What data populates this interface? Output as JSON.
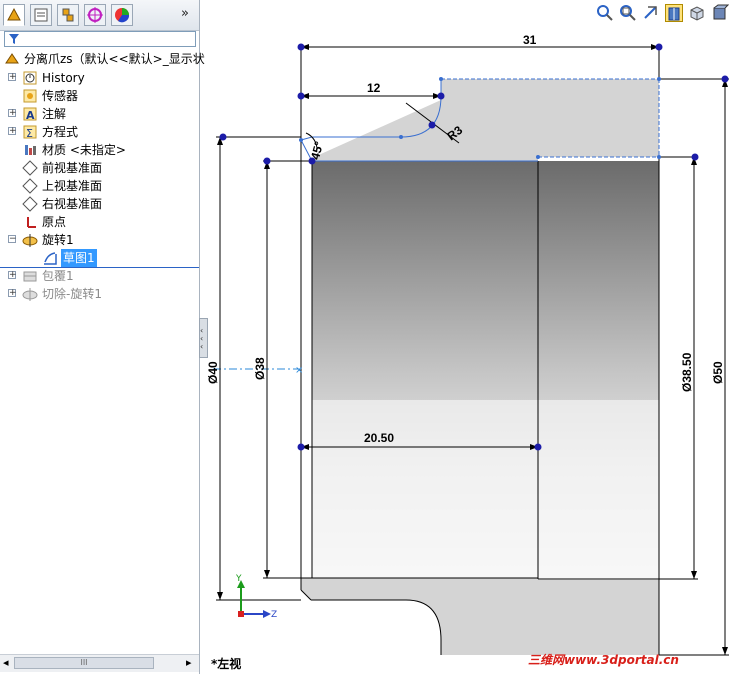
{
  "feature_manager": {
    "part_name": "分离爪zs（默认<<默认>_显示状",
    "tabs": [
      "feature-manager-tab",
      "property-manager-tab",
      "configuration-manager-tab",
      "dimxpert-manager-tab",
      "display-manager-tab"
    ],
    "more": "»",
    "items": [
      {
        "label": "History",
        "icon": "history-icon",
        "expandable": true
      },
      {
        "label": "传感器",
        "icon": "sensors-icon",
        "expandable": false
      },
      {
        "label": "注解",
        "icon": "annotations-icon",
        "expandable": true
      },
      {
        "label": "方程式",
        "icon": "equations-icon",
        "expandable": true
      },
      {
        "label": "材质 <未指定>",
        "icon": "material-icon",
        "expandable": false
      },
      {
        "label": "前视基准面",
        "icon": "plane-icon",
        "expandable": false
      },
      {
        "label": "上视基准面",
        "icon": "plane-icon",
        "expandable": false
      },
      {
        "label": "右视基准面",
        "icon": "plane-icon",
        "expandable": false
      },
      {
        "label": "原点",
        "icon": "origin-icon",
        "expandable": false
      },
      {
        "label": "旋转1",
        "icon": "revolve-icon",
        "expandable": true
      },
      {
        "label": "草图1",
        "icon": "sketch-icon",
        "expandable": false
      },
      {
        "label": "包覆1",
        "icon": "wrap-icon",
        "expandable": true
      },
      {
        "label": "切除-旋转1",
        "icon": "cut-revolve-icon",
        "expandable": true
      }
    ],
    "scroll_arrows": {
      "left": "◂",
      "mid": "III",
      "right": "▸"
    }
  },
  "graphics": {
    "dimensions": {
      "d31": "31",
      "d12": "12",
      "r3": "R3",
      "a45": "45°",
      "d2050": "20.50",
      "dia40": "Ø40",
      "dia38": "Ø38",
      "dia3850": "Ø38.50",
      "dia50": "Ø50"
    },
    "triad": {
      "y": "Y",
      "z": "Z"
    },
    "view_name": "*左视",
    "watermark": "三维网www.3dportal.cn"
  },
  "view_toolbar": [
    "zoom-to-fit-icon",
    "zoom-to-area-icon",
    "previous-view-icon",
    "section-view-icon",
    "view-orientation-icon",
    "display-style-icon"
  ],
  "colors": {
    "sketch_point": "#1c1ca8",
    "selected_tree": "#3399ff",
    "section_fill": "#d4d4d4"
  }
}
